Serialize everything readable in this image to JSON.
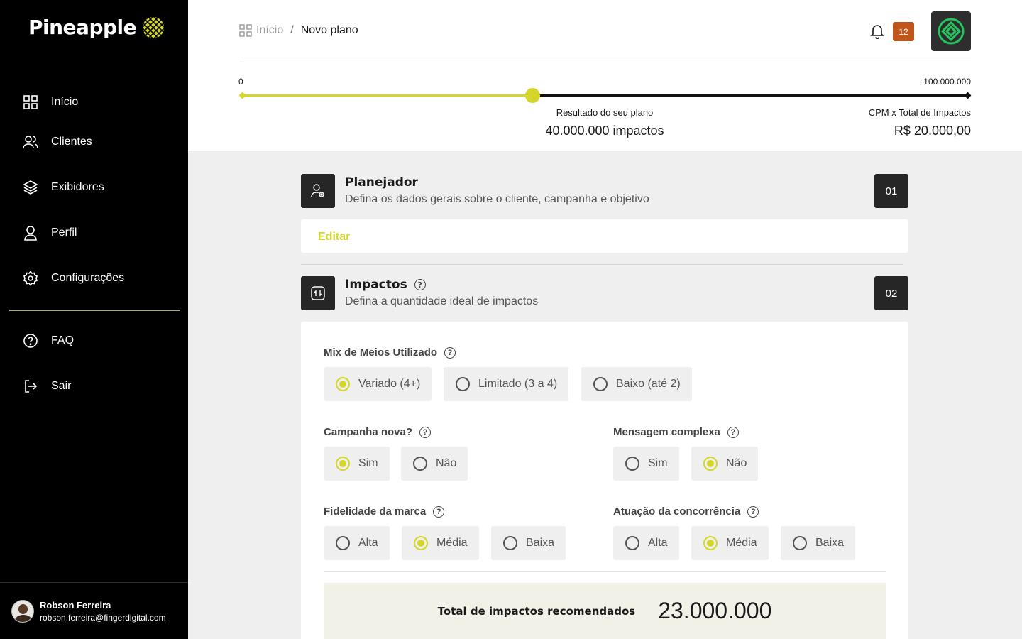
{
  "brand": {
    "name": "Pineapple",
    "accent": "#d4d62b"
  },
  "sidebar": {
    "items": [
      {
        "label": "Início",
        "icon": "grid-icon"
      },
      {
        "label": "Clientes",
        "icon": "users-icon"
      },
      {
        "label": "Exibidores",
        "icon": "layers-icon"
      },
      {
        "label": "Perfil",
        "icon": "user-icon"
      },
      {
        "label": "Configurações",
        "icon": "gear-icon"
      },
      {
        "label": "FAQ",
        "icon": "help-icon"
      },
      {
        "label": "Sair",
        "icon": "logout-icon"
      }
    ],
    "user": {
      "name": "Robson Ferreira",
      "email": "robson.ferreira@fingerdigital.com"
    }
  },
  "header": {
    "breadcrumb": {
      "home": "Início",
      "separator": "/",
      "current": "Novo plano"
    },
    "notifications": "12",
    "slider": {
      "min_label": "0",
      "max_label": "100.000.000",
      "fraction": 0.4,
      "result_label": "Resultado do seu plano",
      "result_value": "40.000.000 impactos",
      "cpm_label": "CPM x Total de Impactos",
      "cpm_value": "R$ 20.000,00"
    }
  },
  "steps": {
    "planner": {
      "title": "Planejador",
      "subtitle": "Defina os dados gerais sobre o cliente, campanha e objetivo",
      "number": "01",
      "edit_label": "Editar"
    },
    "impacts": {
      "title": "Impactos",
      "subtitle": "Defina a quantidade ideal de impactos",
      "number": "02"
    }
  },
  "form": {
    "mix": {
      "label": "Mix de Meios Utilizado",
      "options": [
        "Variado (4+)",
        "Limitado (3 a 4)",
        "Baixo (até 2)"
      ],
      "selected": 0
    },
    "new_campaign": {
      "label": "Campanha nova?",
      "options": [
        "Sim",
        "Não"
      ],
      "selected": 0
    },
    "complex_message": {
      "label": "Mensagem complexa",
      "options": [
        "Sim",
        "Não"
      ],
      "selected": 1
    },
    "brand_loyalty": {
      "label": "Fidelidade da marca",
      "options": [
        "Alta",
        "Média",
        "Baixa"
      ],
      "selected": 1
    },
    "competition": {
      "label": "Atuação da concorrência",
      "options": [
        "Alta",
        "Média",
        "Baixa"
      ],
      "selected": 1
    },
    "total": {
      "label": "Total de impactos recomendados",
      "value": "23.000.000"
    }
  }
}
